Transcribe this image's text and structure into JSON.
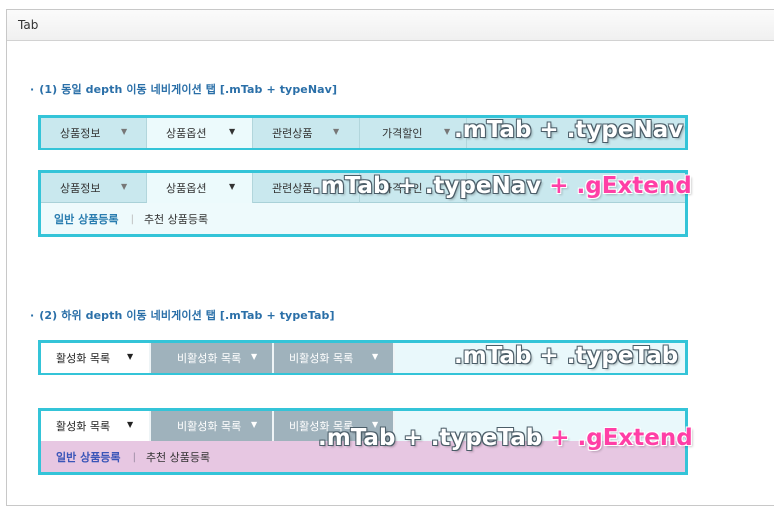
{
  "header": {
    "title": "Tab"
  },
  "sections": [
    {
      "bullet": "·",
      "title": "(1) 동일 depth 이동 네비게이션 탭 [.mTab + typeNav]"
    },
    {
      "bullet": "·",
      "title": "(2) 하위 depth 이동 네비게이션 탭 [.mTab + typeTab]"
    }
  ],
  "nav1": {
    "tabs": [
      "상품정보",
      "상품옵션",
      "관련상품",
      "가격할인"
    ],
    "label_main": ".mTab + .typeNav"
  },
  "nav2": {
    "tabs": [
      "상품정보",
      "상품옵션",
      "관련상품",
      "가격할인"
    ],
    "sub": [
      "일반 상품등록",
      "추천 상품등록"
    ],
    "sep": "|",
    "label_main": ".mTab + .typeNav",
    "label_ext": "+ .gExtend"
  },
  "tab1": {
    "tabs": [
      "활성화 목록",
      "비활성화 목록",
      "비활성화 목록"
    ],
    "label_main": ".mTab + .typeTab"
  },
  "tab2": {
    "tabs": [
      "활성화 목록",
      "비활성화 목록",
      "비활성화 목록"
    ],
    "sub": [
      "일반 상품등록",
      "추천 상품등록"
    ],
    "sep": "|",
    "label_main": ".mTab + .typeTab",
    "label_ext": "+ .gExtend"
  },
  "icons": {
    "dropdown": "chevron-down-icon"
  },
  "colors": {
    "frame": "#34c4d8",
    "extend_text": "#ff3fa6",
    "extend_bg": "#e7c7e2",
    "sub_active": "#2a7db0",
    "inactive_tab": "#9fb2bc"
  }
}
